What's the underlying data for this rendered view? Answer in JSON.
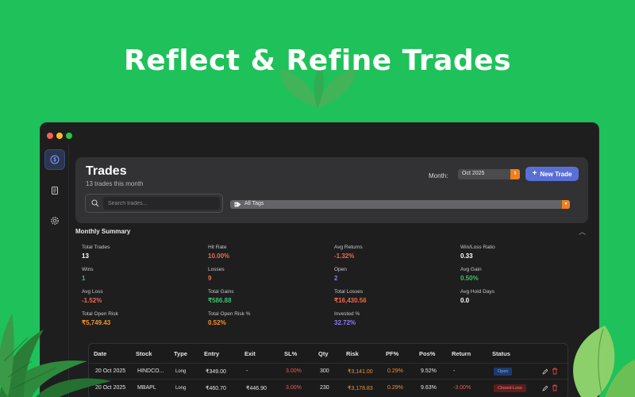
{
  "headline": "Reflect & Refine Trades",
  "page": {
    "title": "Trades",
    "subtitle": "13 trades this month",
    "month_label": "Month:",
    "month_value": "Oct 2025",
    "new_trade_label": "New Trade",
    "search_placeholder": "Search trades...",
    "tags_value": "All Tags"
  },
  "summary": {
    "title": "Monthly Summary",
    "stats": [
      {
        "label": "Total Trades",
        "value": "13",
        "color": "#ffffff"
      },
      {
        "label": "Hit Rate",
        "value": "10.00%",
        "color": "#ef6a4e"
      },
      {
        "label": "Avg Returns",
        "value": "-1.32%",
        "color": "#ef6a4e"
      },
      {
        "label": "Win/Loss Ratio",
        "value": "0.33",
        "color": "#ffffff"
      },
      {
        "label": "Wins",
        "value": "1",
        "color": "#3fbf6a"
      },
      {
        "label": "Losses",
        "value": "9",
        "color": "#ef6a4e"
      },
      {
        "label": "Open",
        "value": "2",
        "color": "#8e7cf0"
      },
      {
        "label": "Avg Gain",
        "value": "0.50%",
        "color": "#3fbf6a"
      },
      {
        "label": "Avg Loss",
        "value": "-1.52%",
        "color": "#ef6a4e"
      },
      {
        "label": "Total Gains",
        "value": "₹586.88",
        "color": "#3fbf6a"
      },
      {
        "label": "Total Losses",
        "value": "₹16,430.56",
        "color": "#ef6a4e"
      },
      {
        "label": "Avg Hold Days",
        "value": "0.0",
        "color": "#ffffff"
      },
      {
        "label": "Total Open Risk",
        "value": "₹5,749.43",
        "color": "#f0922e"
      },
      {
        "label": "Total Open Risk %",
        "value": "0.52%",
        "color": "#f0922e"
      },
      {
        "label": "Invested %",
        "value": "32.72%",
        "color": "#8e7cf0"
      }
    ]
  },
  "table": {
    "headers": [
      "Date",
      "Stock",
      "Type",
      "Entry",
      "Exit",
      "SL%",
      "Qty",
      "Risk",
      "PF%",
      "Pos%",
      "Return",
      "Status"
    ],
    "rows": [
      {
        "date": "20 Oct 2025",
        "stock": "HINDCO...",
        "type": "Long",
        "entry": "₹349.00",
        "exit": "-",
        "sl": "3.00%",
        "qty": "300",
        "risk": "₹3,141.00",
        "pf": "0.29%",
        "pos": "9.52%",
        "ret": "-",
        "status": "Open"
      },
      {
        "date": "20 Oct 2025",
        "stock": "MBAPL",
        "type": "Long",
        "entry": "₹460.70",
        "exit": "₹446.90",
        "sl": "3.00%",
        "qty": "230",
        "risk": "₹3,178.83",
        "pf": "0.29%",
        "pos": "9.63%",
        "ret": "-3.00%",
        "status": "Closed-Loss"
      }
    ]
  },
  "colors": {
    "background": "#1fc15a",
    "accent": "#5a6fd6",
    "orange": "#f07f1c",
    "loss": "#ef6a4e",
    "gain": "#3fbf6a"
  },
  "icons": {
    "sidebar": [
      "dollar-circle-icon",
      "journal-icon",
      "gear-icon"
    ]
  }
}
